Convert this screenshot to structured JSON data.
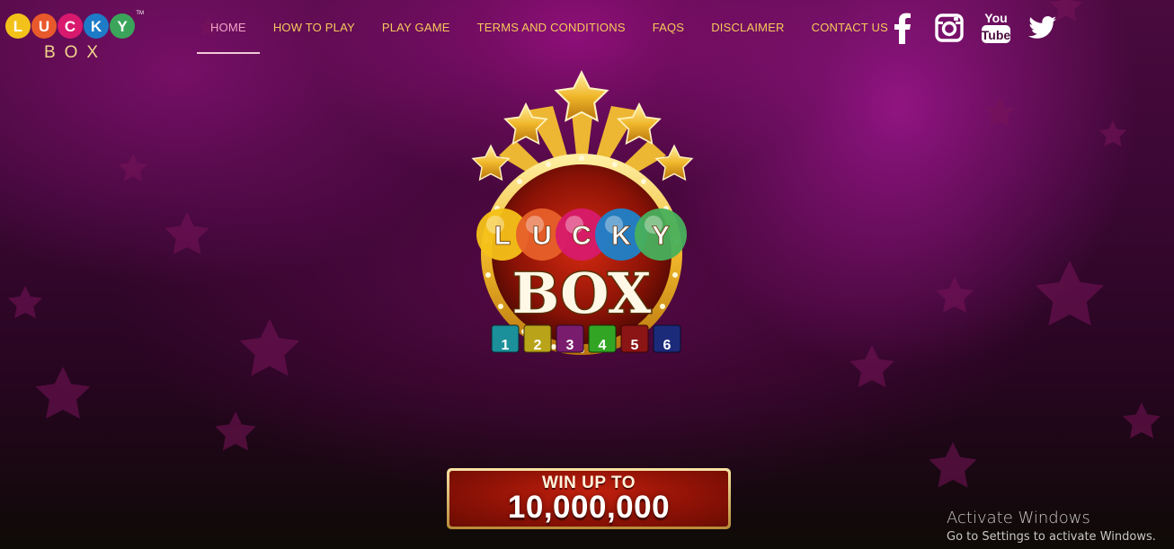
{
  "logo": {
    "letters": [
      "L",
      "U",
      "C",
      "K",
      "Y"
    ],
    "letter_colors": [
      "#f3c21a",
      "#e8592b",
      "#d8196e",
      "#1d7bc7",
      "#3aa55a"
    ],
    "word": "BOX",
    "trademark": "TM"
  },
  "nav": {
    "items": [
      {
        "label": "HOME",
        "active": true
      },
      {
        "label": "HOW TO PLAY"
      },
      {
        "label": "PLAY GAME"
      },
      {
        "label": "TERMS AND CONDITIONS"
      },
      {
        "label": "FAQS"
      },
      {
        "label": "DISCLAIMER"
      },
      {
        "label": "CONTACT US"
      }
    ]
  },
  "social": [
    "facebook-icon",
    "instagram-icon",
    "youtube-icon",
    "twitter-icon"
  ],
  "emblem": {
    "letters": [
      "L",
      "U",
      "C",
      "K",
      "Y"
    ],
    "word": "BOX",
    "cubes": [
      "1",
      "2",
      "3",
      "4",
      "5",
      "6"
    ],
    "cube_colors": [
      "#1b8f9a",
      "#b9a319",
      "#7a1c6e",
      "#33a524",
      "#8b1414",
      "#1c2a7a"
    ]
  },
  "win": {
    "line1": "WIN UP TO",
    "line2": "10,000,000"
  },
  "activate_windows": {
    "title": "Activate Windows",
    "subtitle": "Go to Settings to activate Windows."
  },
  "colors": {
    "nav_text": "#f6c95a",
    "nav_active": "#f2a4c8",
    "background": "#3a0733"
  }
}
